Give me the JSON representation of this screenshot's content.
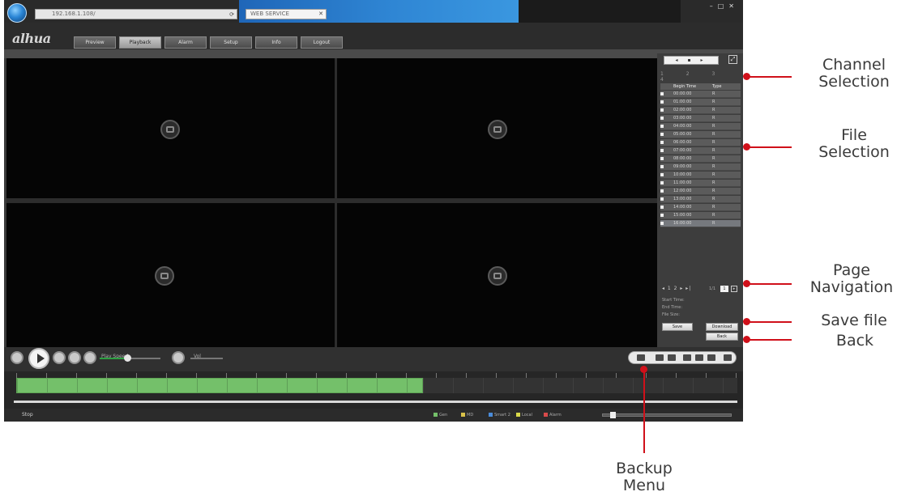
{
  "window": {
    "address": "192.168.1.108/",
    "tab_label": "WEB SERVICE",
    "logo": "alhua"
  },
  "nav_tabs": [
    {
      "label": "Preview",
      "active": false
    },
    {
      "label": "Playback",
      "active": true
    },
    {
      "label": "Alarm",
      "active": false
    },
    {
      "label": "Setup",
      "active": false
    },
    {
      "label": "Info",
      "active": false
    },
    {
      "label": "Logout",
      "active": false
    }
  ],
  "sidebar": {
    "calendar_toggle": "◂ ▪ ▸",
    "channel_row": "1 2 3 4",
    "file_table": {
      "headers": [
        "Begin Time",
        "Type"
      ],
      "rows": [
        {
          "time": "00:00:00",
          "type": "R"
        },
        {
          "time": "01:00:00",
          "type": "R"
        },
        {
          "time": "02:00:00",
          "type": "R"
        },
        {
          "time": "03:00:00",
          "type": "R"
        },
        {
          "time": "04:00:00",
          "type": "R"
        },
        {
          "time": "05:00:00",
          "type": "R"
        },
        {
          "time": "06:00:00",
          "type": "R"
        },
        {
          "time": "07:00:00",
          "type": "R"
        },
        {
          "time": "08:00:00",
          "type": "R"
        },
        {
          "time": "09:00:00",
          "type": "R"
        },
        {
          "time": "10:00:00",
          "type": "R"
        },
        {
          "time": "11:00:00",
          "type": "R"
        },
        {
          "time": "12:00:00",
          "type": "R"
        },
        {
          "time": "13:00:00",
          "type": "R"
        },
        {
          "time": "14:00:00",
          "type": "R"
        },
        {
          "time": "15:00:00",
          "type": "R"
        },
        {
          "time": "16:00:00",
          "type": "R"
        }
      ],
      "selected_index": 16
    },
    "pager": {
      "nums": "◂ 1 2 ▸ ▸|",
      "goto": "1/1",
      "page": "1",
      "go": "▸"
    },
    "info": [
      "Start Time:",
      "End Time:",
      "File Size:"
    ],
    "download_label": "Download",
    "back_label": "Back",
    "save_label": "Save"
  },
  "controls": {
    "speed_label": "Play Speed",
    "volume_label": "Vol",
    "playback_progress": 0.45
  },
  "status": {
    "message": "Stop",
    "legend": [
      {
        "label": "Gen",
        "color": "#74c06a"
      },
      {
        "label": "MD",
        "color": "#d9c24a"
      },
      {
        "label": "Smart 2",
        "color": "#4a8bd9"
      },
      {
        "label": "Local",
        "color": "#d9d94a"
      },
      {
        "label": "Alarm",
        "color": "#d94a4a"
      }
    ]
  },
  "annotations": [
    {
      "label": "Channel\nSelection"
    },
    {
      "label": "File\nSelection"
    },
    {
      "label": "Page\nNavigation"
    },
    {
      "label": "Save file"
    },
    {
      "label": "Back"
    },
    {
      "label": "Backup\nMenu"
    }
  ],
  "colors": {
    "accent": "#d0101a",
    "record_green": "#74c06a"
  }
}
